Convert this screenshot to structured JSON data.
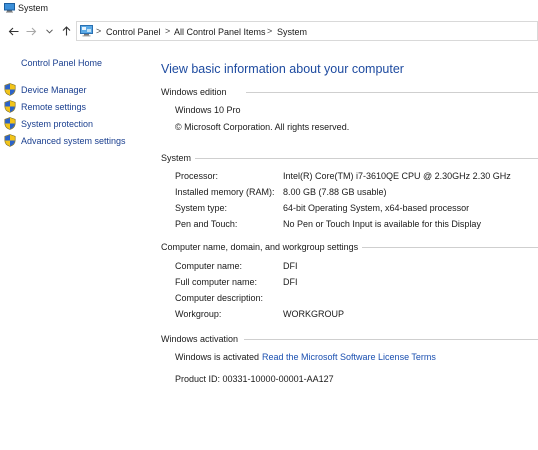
{
  "window": {
    "title": "System"
  },
  "address_bar": {
    "breadcrumbs": [
      "Control Panel",
      "All Control Panel Items",
      "System"
    ],
    "separator": ">"
  },
  "sidebar": {
    "home": "Control Panel Home",
    "links": [
      "Device Manager",
      "Remote settings",
      "System protection",
      "Advanced system settings"
    ]
  },
  "main": {
    "title": "View basic information about your computer",
    "windows_edition": {
      "heading": "Windows edition",
      "edition": "Windows 10 Pro",
      "copyright": "© Microsoft Corporation. All rights reserved."
    },
    "system": {
      "heading": "System",
      "rows": [
        {
          "label": "Processor:",
          "value": "Intel(R) Core(TM) i7-3610QE CPU @ 2.30GHz   2.30 GHz"
        },
        {
          "label": "Installed memory (RAM):",
          "value": "8.00 GB (7.88 GB usable)"
        },
        {
          "label": "System type:",
          "value": "64-bit Operating System, x64-based processor"
        },
        {
          "label": "Pen and Touch:",
          "value": "No Pen or Touch Input is available for this Display"
        }
      ]
    },
    "computer_name": {
      "heading": "Computer name, domain, and workgroup settings",
      "rows": [
        {
          "label": "Computer name:",
          "value": "DFI"
        },
        {
          "label": "Full computer name:",
          "value": "DFI"
        },
        {
          "label": "Computer description:",
          "value": ""
        },
        {
          "label": "Workgroup:",
          "value": "WORKGROUP"
        }
      ]
    },
    "activation": {
      "heading": "Windows activation",
      "status": "Windows is activated",
      "license_link": "Read the Microsoft Software License Terms",
      "product_id": "Product ID:  00331-10000-00001-AA127"
    }
  },
  "colors": {
    "link": "#1a3f8f",
    "title": "#1e4ba0",
    "accent": "#1a4fb0"
  },
  "icons": {
    "back": "arrow-left",
    "forward": "arrow-right",
    "recent": "chevron-down",
    "up": "arrow-up",
    "shield": "uac-shield"
  }
}
